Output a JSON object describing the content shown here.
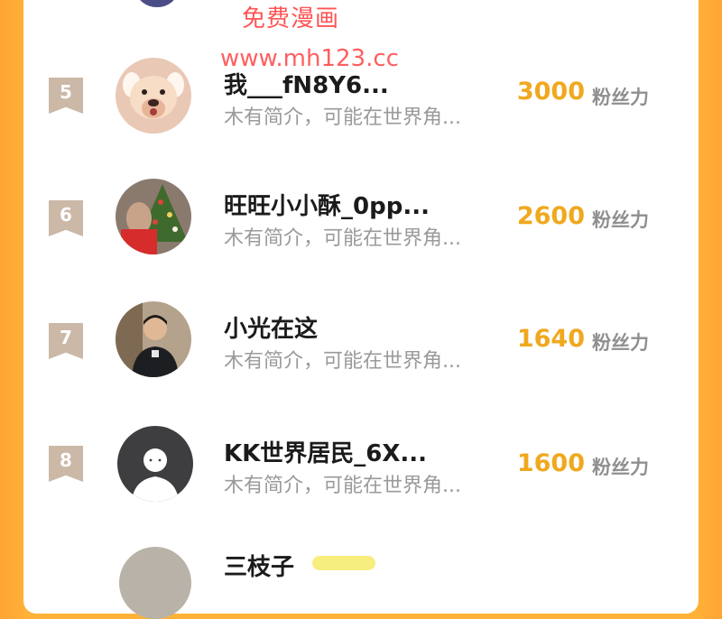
{
  "watermark": {
    "line1": "免费漫画",
    "line2": "www.mh123.cc"
  },
  "ranking": [
    {
      "rank": "5",
      "name": "我___fN8Y6...",
      "bio": "木有简介，可能在世界角...",
      "count": "3000",
      "unit": "粉丝力",
      "avatar": "dog-avatar"
    },
    {
      "rank": "6",
      "name": "旺旺小小酥_0pp...",
      "bio": "木有简介，可能在世界角...",
      "count": "2600",
      "unit": "粉丝力",
      "avatar": "christmas-avatar"
    },
    {
      "rank": "7",
      "name": "小光在这",
      "bio": "木有简介，可能在世界角...",
      "count": "1640",
      "unit": "粉丝力",
      "avatar": "person-photo-avatar"
    },
    {
      "rank": "8",
      "name": "KK世界居民_6X...",
      "bio": "木有简介，可能在世界角...",
      "count": "1600",
      "unit": "粉丝力",
      "avatar": "default-avatar"
    }
  ],
  "next_row": {
    "name": "三枝子"
  },
  "colors": {
    "background": "#ffb238",
    "count": "#f0a81e",
    "rank_badge": "#cbb8a7"
  }
}
